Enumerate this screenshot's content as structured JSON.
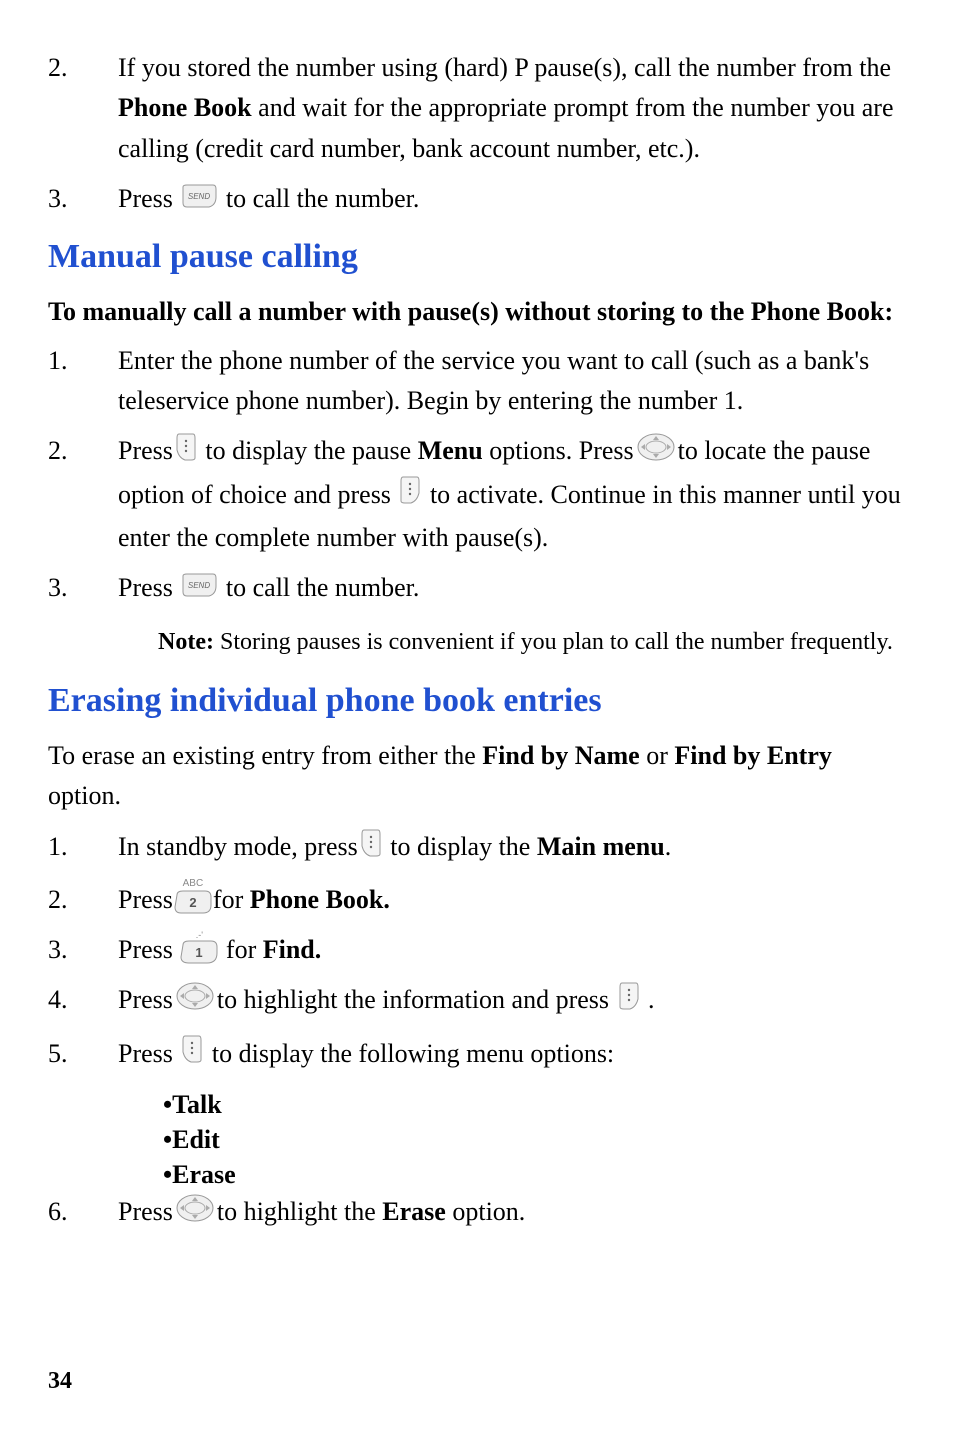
{
  "list1": {
    "item2": {
      "num": "2.",
      "text_a": "If you stored the number using (hard) P pause(s), call the number from the ",
      "text_b": "Phone Book",
      "text_c": " and wait for the appropriate prompt from the number you are calling (credit card number, bank account number, etc.)."
    },
    "item3": {
      "num": "3.",
      "text_a": "Press ",
      "text_b": " to call the number."
    }
  },
  "heading1": "Manual pause calling",
  "subheading1": "To manually call a number with pause(s) without storing to the Phone Book:",
  "list2": {
    "item1": {
      "num": "1.",
      "text": "Enter the phone number of the service you want to call (such as a bank's teleservice phone number). Begin by entering the number 1."
    },
    "item2": {
      "num": "2.",
      "text_a": "Press",
      "text_b": " to display the pause ",
      "text_c": "Menu",
      "text_d": " options. Press",
      "text_e": "to locate the pause option of choice and press ",
      "text_f": " to activate. Continue in this manner until you enter the complete number with pause(s)."
    },
    "item3": {
      "num": "3.",
      "text_a": "Press ",
      "text_b": " to call the number."
    }
  },
  "note": {
    "label": "Note:",
    "text": " Storing pauses is convenient if you plan to call the number frequently."
  },
  "heading2": "Erasing individual phone book entries",
  "intro": {
    "text_a": "To erase an existing entry from either the ",
    "text_b": "Find by Name",
    "text_c": " or ",
    "text_d": "Find by Entry",
    "text_e": " option."
  },
  "list3": {
    "item1": {
      "num": "1.",
      "text_a": "In standby mode, press",
      "text_b": " to display the ",
      "text_c": "Main menu",
      "text_d": "."
    },
    "item2": {
      "num": "2.",
      "text_a": "Press",
      "text_b": "for ",
      "text_c": "Phone Book."
    },
    "item3": {
      "num": "3.",
      "text_a": "Press ",
      "text_b": " for ",
      "text_c": "Find."
    },
    "item4": {
      "num": "4.",
      "text_a": "Press",
      "text_b": "to highlight the information and press ",
      "text_c": " ."
    },
    "item5": {
      "num": "5.",
      "text_a": "Press ",
      "text_b": " to display the following menu options:"
    },
    "item6": {
      "num": "6.",
      "text_a": "Press",
      "text_b": "to highlight the ",
      "text_c": "Erase",
      "text_d": " option."
    }
  },
  "bullets": {
    "b1": "•Talk",
    "b2": "•Edit",
    "b3": "•Erase"
  },
  "num2_label": "ABC",
  "num1_label": ".-'",
  "page_number": "34"
}
